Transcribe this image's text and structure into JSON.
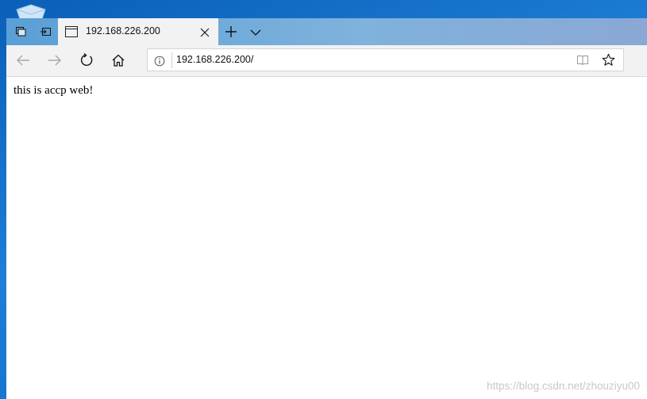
{
  "browser": {
    "tab": {
      "title": "192.168.226.200"
    },
    "address_bar": {
      "url": "192.168.226.200/"
    },
    "icons": {
      "set_aside_tabs": "set-aside-tabs-icon",
      "show_tabs": "show-set-aside-tabs-icon",
      "page": "page-icon",
      "close": "close-icon",
      "new_tab": "plus-icon",
      "tab_list": "chevron-down-icon",
      "back": "back-arrow-icon",
      "forward": "forward-arrow-icon",
      "refresh": "refresh-icon",
      "home": "home-icon",
      "site_info": "info-icon",
      "reading_view": "reading-view-icon",
      "favorite": "star-icon"
    }
  },
  "page": {
    "body_text": "this is accp web!"
  },
  "overlay": {
    "watermark": "https://blog.csdn.net/zhouziyu00"
  },
  "colors": {
    "desktop": "#1e7fd6",
    "tabbar": "#7fb2dc",
    "toolbar": "#f2f2f2"
  }
}
